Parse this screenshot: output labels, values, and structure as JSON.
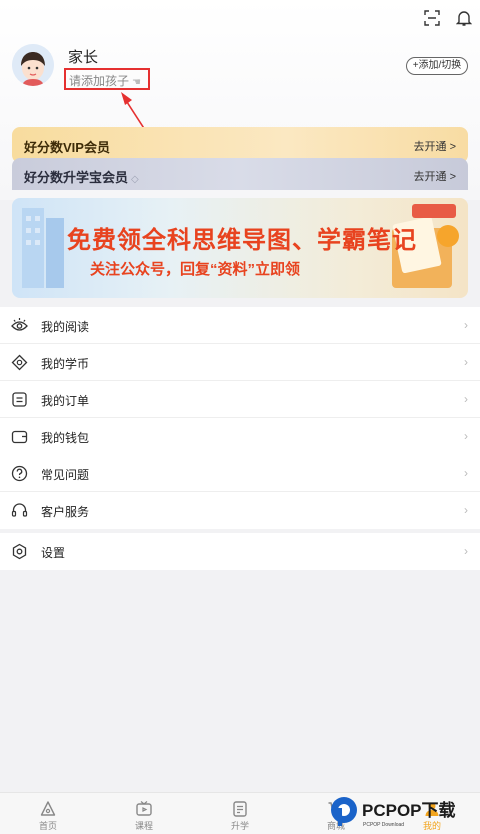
{
  "header": {
    "username": "家长",
    "add_child_label": "请添加孩子",
    "add_switch_label": "+添加/切换",
    "icons": [
      "scan-icon",
      "bell-icon"
    ]
  },
  "membership": {
    "vip_title": "好分数VIP会员",
    "vip_action": "去开通 >",
    "sx_title": "好分数升学宝会员",
    "sx_action": "去开通 >"
  },
  "banner": {
    "headline": "免费领全科思维导图、学霸笔记",
    "subline": "关注公众号，回复“资料”立即领"
  },
  "menu": {
    "group1": [
      {
        "label": "我的阅读",
        "icon": "eye-icon"
      },
      {
        "label": "我的学币",
        "icon": "coin-icon"
      },
      {
        "label": "我的订单",
        "icon": "order-icon"
      },
      {
        "label": "我的钱包",
        "icon": "wallet-icon"
      }
    ],
    "group2": [
      {
        "label": "常见问题",
        "icon": "question-icon"
      },
      {
        "label": "客户服务",
        "icon": "headset-icon"
      }
    ],
    "group3": [
      {
        "label": "设置",
        "icon": "settings-icon"
      }
    ]
  },
  "tabbar": [
    {
      "label": "首页",
      "icon": "home-icon"
    },
    {
      "label": "课程",
      "icon": "tv-icon"
    },
    {
      "label": "升学",
      "icon": "doc-icon"
    },
    {
      "label": "商城",
      "icon": "cart-icon"
    },
    {
      "label": "我的",
      "icon": "user-icon",
      "active": true
    }
  ],
  "watermark": {
    "brand": "PCPOP下载",
    "sub": "PCPOP Download"
  },
  "colors": {
    "accent": "#f3a51e",
    "highlight_box": "#e53030",
    "banner_text": "#e8431f"
  }
}
